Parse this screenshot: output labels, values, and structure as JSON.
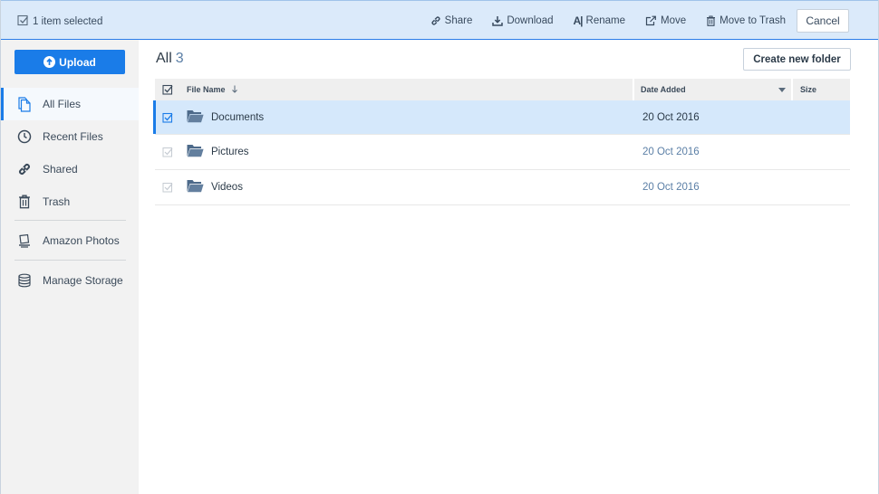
{
  "selection": {
    "count_label": "1 item selected"
  },
  "actions": {
    "share": "Share",
    "download": "Download",
    "rename": "Rename",
    "move": "Move",
    "trash": "Move to Trash",
    "cancel": "Cancel"
  },
  "sidebar": {
    "upload": "Upload",
    "items": [
      {
        "label": "All Files",
        "icon": "file-icon"
      },
      {
        "label": "Recent Files",
        "icon": "clock-icon"
      },
      {
        "label": "Shared",
        "icon": "link-icon"
      },
      {
        "label": "Trash",
        "icon": "trash-icon"
      },
      {
        "label": "Amazon Photos",
        "icon": "photos-icon"
      },
      {
        "label": "Manage Storage",
        "icon": "storage-icon"
      }
    ]
  },
  "main": {
    "title": "All",
    "count": "3",
    "create_folder": "Create new folder",
    "columns": {
      "name": "File Name",
      "date": "Date Added",
      "size": "Size"
    },
    "rows": [
      {
        "name": "Documents",
        "date": "20 Oct 2016",
        "selected": true
      },
      {
        "name": "Pictures",
        "date": "20 Oct 2016",
        "selected": false
      },
      {
        "name": "Videos",
        "date": "20 Oct 2016",
        "selected": false
      }
    ]
  },
  "colors": {
    "accent": "#1a7ce8",
    "selection_bg": "#dbeafa",
    "row_selected": "#d5e8fb",
    "sidebar_bg": "#f2f2f2"
  }
}
